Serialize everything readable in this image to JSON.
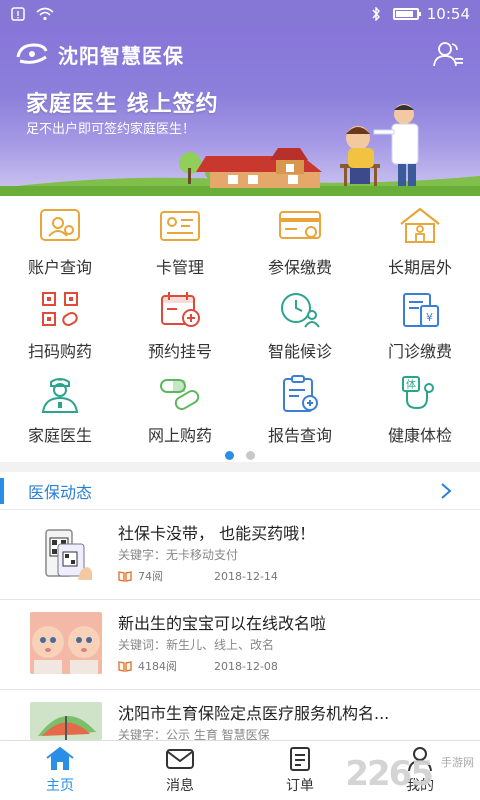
{
  "status_bar": {
    "time": "10:54",
    "battery_level": 0.8
  },
  "header": {
    "title": "沈阳智慧医保",
    "user_icon": "user-group-icon"
  },
  "banner": {
    "title": "家庭医生  线上签约",
    "subtitle": "足不出户即可签约家庭医生！"
  },
  "grid": [
    {
      "label": "账户查询",
      "icon": "account-search-icon",
      "color": "#e8a53a"
    },
    {
      "label": "卡管理",
      "icon": "card-manage-icon",
      "color": "#e8a53a"
    },
    {
      "label": "参保缴费",
      "icon": "insurance-card-icon",
      "color": "#e8a53a"
    },
    {
      "label": "长期居外",
      "icon": "house-icon",
      "color": "#e8a53a"
    },
    {
      "label": "扫码购药",
      "icon": "qr-code-icon",
      "color": "#e04a3a"
    },
    {
      "label": "预约挂号",
      "icon": "calendar-add-icon",
      "color": "#e04a3a"
    },
    {
      "label": "智能候诊",
      "icon": "clock-user-icon",
      "color": "#2aa48c"
    },
    {
      "label": "门诊缴费",
      "icon": "bill-yuan-icon",
      "color": "#3a7ed8"
    },
    {
      "label": "家庭医生",
      "icon": "doctor-icon",
      "color": "#2aa48c"
    },
    {
      "label": "网上购药",
      "icon": "pill-icon",
      "color": "#5cb85c"
    },
    {
      "label": "报告查询",
      "icon": "report-icon",
      "color": "#3a7ed8"
    },
    {
      "label": "健康体检",
      "icon": "stethoscope-icon",
      "color": "#2aa48c"
    }
  ],
  "pager": {
    "count": 2,
    "active": 1
  },
  "news": {
    "section_title": "医保动态",
    "items": [
      {
        "title": "社保卡没带，  也能买药哦！",
        "keywords": "关键字：无卡移动支付",
        "views": "74阅",
        "date": "2018-12-14"
      },
      {
        "title": "新出生的宝宝可以在线改名啦",
        "keywords": "关键词：新生儿、线上、改名",
        "views": "4184阅",
        "date": "2018-12-08"
      },
      {
        "title": "沈阳市生育保险定点医疗服务机构名...",
        "keywords": "关键字：公示  生育  智慧医保",
        "views": "",
        "date": ""
      }
    ]
  },
  "tabs": [
    {
      "label": "主页",
      "icon": "home-icon"
    },
    {
      "label": "消息",
      "icon": "mail-icon"
    },
    {
      "label": "订单",
      "icon": "order-icon"
    },
    {
      "label": "我的",
      "icon": "user-icon"
    }
  ],
  "watermark": {
    "number": "2265",
    "text": "手游网"
  },
  "colors": {
    "primary": "#2a8de6",
    "header": "#8676d6"
  }
}
